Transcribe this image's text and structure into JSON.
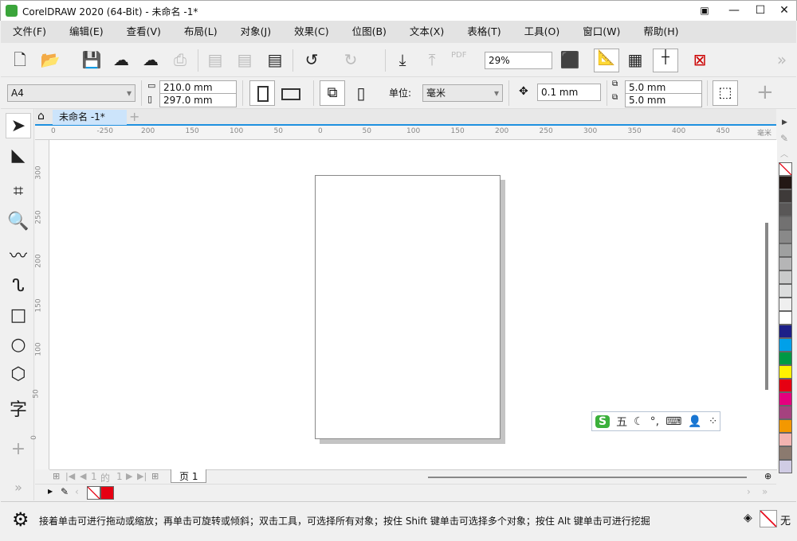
{
  "window": {
    "title": "CorelDRAW 2020 (64-Bit) - 未命名 -1*",
    "controls": [
      "minimize",
      "maximize",
      "close"
    ]
  },
  "menu": [
    "文件(F)",
    "编辑(E)",
    "查看(V)",
    "布局(L)",
    "对象(J)",
    "效果(C)",
    "位图(B)",
    "文本(X)",
    "表格(T)",
    "工具(O)",
    "窗口(W)",
    "帮助(H)"
  ],
  "toolbar": {
    "zoom": "29%",
    "pdf_label": "PDF"
  },
  "propbar": {
    "page_size": "A4",
    "width": "210.0 mm",
    "height": "297.0 mm",
    "units_label": "单位:",
    "units": "毫米",
    "nudge": "0.1 mm",
    "dup_x": "5.0 mm",
    "dup_y": "5.0 mm"
  },
  "tabs": {
    "document": "未命名 -1*"
  },
  "ruler": {
    "unit": "毫米",
    "h_labels": [
      "0",
      "-250",
      "200",
      "150",
      "100",
      "50",
      "0",
      "50",
      "100",
      "150",
      "200",
      "250",
      "300",
      "350",
      "400",
      "450"
    ],
    "v_labels": [
      "300",
      "250",
      "200",
      "150",
      "100",
      "50",
      "0"
    ]
  },
  "pagenav": {
    "current": "1",
    "of": "的",
    "total": "1",
    "page_tab": "页 1"
  },
  "ime": {
    "mode": "五"
  },
  "palette": [
    "none",
    "#231815",
    "#3e3a39",
    "#595757",
    "#727171",
    "#898989",
    "#9fa0a0",
    "#b5b5b6",
    "#c9caca",
    "#dcdddd",
    "#efefef",
    "#ffffff",
    "#1d2088",
    "#00a0e9",
    "#009944",
    "#fff100",
    "#e60012",
    "#e4007f",
    "#a5427f",
    "#f39800",
    "#f2b3b0",
    "#8b7a6f",
    "#d0cce4"
  ],
  "status": {
    "hint": "接着单击可进行拖动或缩放；再单击可旋转或倾斜；双击工具，可选择所有对象；按住 Shift 键单击可选择多个对象；按住 Alt 键单击可进行挖掘",
    "fill": "无"
  },
  "colors": {
    "accent": "#1e90e0",
    "outline": "#e60012"
  }
}
